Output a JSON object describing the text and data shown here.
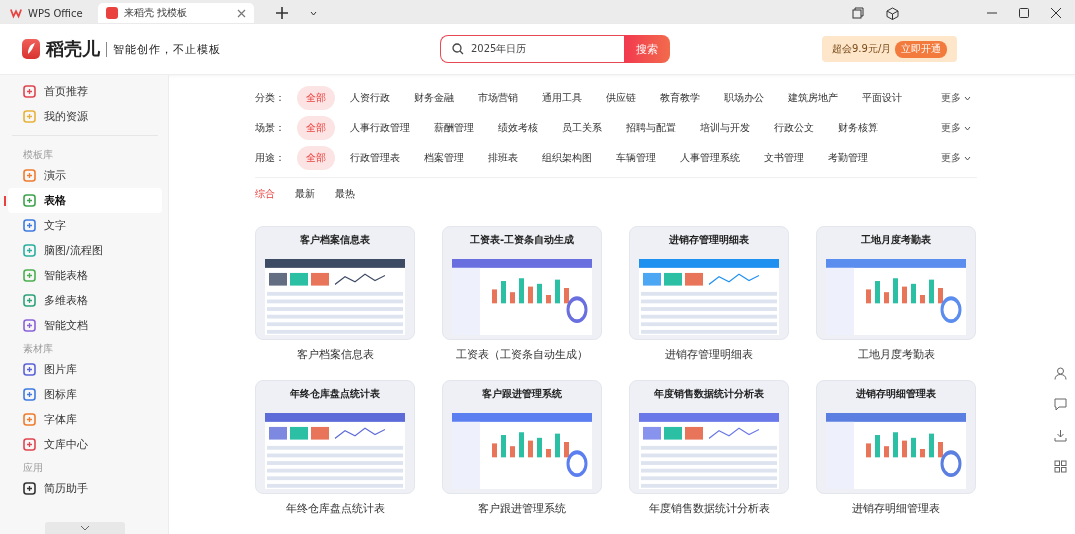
{
  "tabs": [
    {
      "label": "WPS Office",
      "selected": false
    },
    {
      "label": "来稻壳 找模板",
      "selected": true
    }
  ],
  "header": {
    "logo": "稻壳儿",
    "slogan": "智能创作，不止模板",
    "search": {
      "value": "2025年日历"
    },
    "search_button": "搜索",
    "promo": "超会9.9元/月",
    "promo_button": "立即开通"
  },
  "sidebar": {
    "sections": [
      {
        "items": [
          {
            "label": "首页推荐",
            "selected": false
          },
          {
            "label": "我的资源",
            "selected": false
          }
        ]
      },
      {
        "title": "模板库",
        "items": [
          {
            "label": "演示",
            "selected": false
          },
          {
            "label": "表格",
            "selected": true
          },
          {
            "label": "文字",
            "selected": false
          },
          {
            "label": "脑图/流程图",
            "selected": false
          },
          {
            "label": "智能表格",
            "selected": false
          },
          {
            "label": "多维表格",
            "selected": false
          },
          {
            "label": "智能文档",
            "selected": false
          }
        ]
      },
      {
        "title": "素材库",
        "items": [
          {
            "label": "图片库",
            "selected": false
          },
          {
            "label": "图标库",
            "selected": false
          },
          {
            "label": "字体库",
            "selected": false
          },
          {
            "label": "文库中心",
            "selected": false
          }
        ]
      },
      {
        "title": "应用",
        "items": [
          {
            "label": "简历助手",
            "selected": false
          }
        ]
      }
    ]
  },
  "filters": [
    {
      "label": "分类：",
      "more": "更多",
      "options": [
        {
          "label": "全部",
          "selected": true
        },
        {
          "label": "人资行政",
          "selected": false
        },
        {
          "label": "财务金融",
          "selected": false
        },
        {
          "label": "市场营销",
          "selected": false
        },
        {
          "label": "通用工具",
          "selected": false
        },
        {
          "label": "供应链",
          "selected": false
        },
        {
          "label": "教育教学",
          "selected": false
        },
        {
          "label": "职场办公",
          "selected": false
        },
        {
          "label": "建筑房地产",
          "selected": false
        },
        {
          "label": "平面设计",
          "selected": false
        }
      ]
    },
    {
      "label": "场景：",
      "more": "更多",
      "options": [
        {
          "label": "全部",
          "selected": true
        },
        {
          "label": "人事行政管理",
          "selected": false
        },
        {
          "label": "薪酬管理",
          "selected": false
        },
        {
          "label": "绩效考核",
          "selected": false
        },
        {
          "label": "员工关系",
          "selected": false
        },
        {
          "label": "招聘与配置",
          "selected": false
        },
        {
          "label": "培训与开发",
          "selected": false
        },
        {
          "label": "行政公文",
          "selected": false
        },
        {
          "label": "财务核算",
          "selected": false
        }
      ]
    },
    {
      "label": "用途：",
      "more": "更多",
      "options": [
        {
          "label": "全部",
          "selected": true
        },
        {
          "label": "行政管理表",
          "selected": false
        },
        {
          "label": "档案管理",
          "selected": false
        },
        {
          "label": "排班表",
          "selected": false
        },
        {
          "label": "组织架构图",
          "selected": false
        },
        {
          "label": "车辆管理",
          "selected": false
        },
        {
          "label": "人事管理系统",
          "selected": false
        },
        {
          "label": "文书管理",
          "selected": false
        },
        {
          "label": "考勤管理",
          "selected": false
        }
      ]
    }
  ],
  "sort": [
    {
      "label": "综合",
      "selected": true
    },
    {
      "label": "最新",
      "selected": false
    },
    {
      "label": "最热",
      "selected": false
    }
  ],
  "cards": [
    {
      "thumb_title": "客户档案信息表",
      "caption": "客户档案信息表"
    },
    {
      "thumb_title": "工资表-工资条自动生成",
      "caption": "工资表（工资条自动生成）"
    },
    {
      "thumb_title": "进销存管理明细表",
      "caption": "进销存管理明细表"
    },
    {
      "thumb_title": "工地月度考勤表",
      "caption": "工地月度考勤表"
    },
    {
      "thumb_title": "年终仓库盘点统计表",
      "caption": "年终仓库盘点统计表"
    },
    {
      "thumb_title": "客户跟进管理系统",
      "caption": "客户跟进管理系统"
    },
    {
      "thumb_title": "年度销售数据统计分析表",
      "caption": "年度销售数据统计分析表"
    },
    {
      "thumb_title": "进销存明细管理表",
      "caption": "进销存明细管理表"
    }
  ]
}
